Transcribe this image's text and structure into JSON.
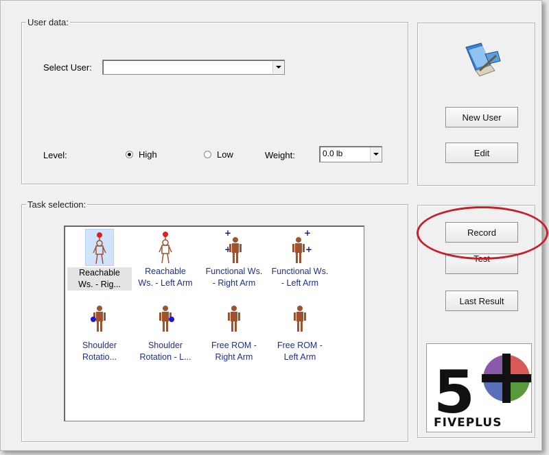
{
  "user_data": {
    "legend": "User data:",
    "select_user_label": "Select User:",
    "select_user_value": "",
    "level_label": "Level:",
    "level_high": "High",
    "level_low": "Low",
    "level_selected": "High",
    "weight_label": "Weight:",
    "weight_value": "0.0 lb"
  },
  "user_actions": {
    "new_user": "New User",
    "edit": "Edit"
  },
  "task_selection": {
    "legend": "Task selection:",
    "tasks": [
      {
        "label": "Reachable\nWs. - Rig...",
        "icon": "reach-right-figure-icon",
        "selected": true
      },
      {
        "label": "Reachable\nWs. - Left Arm",
        "icon": "reach-left-figure-icon",
        "selected": false
      },
      {
        "label": "Functional Ws.\n- Right Arm",
        "icon": "functional-right-figure-icon",
        "selected": false
      },
      {
        "label": "Functional Ws.\n- Left Arm",
        "icon": "functional-left-figure-icon",
        "selected": false
      },
      {
        "label": "Shoulder\nRotatio...",
        "icon": "shoulder-right-figure-icon",
        "selected": false
      },
      {
        "label": "Shoulder\nRotation - L...",
        "icon": "shoulder-left-figure-icon",
        "selected": false
      },
      {
        "label": "Free ROM -\nRight Arm",
        "icon": "free-rom-right-figure-icon",
        "selected": false
      },
      {
        "label": "Free ROM -\nLeft Arm",
        "icon": "free-rom-left-figure-icon",
        "selected": false
      }
    ]
  },
  "task_actions": {
    "record": "Record",
    "test": "Test",
    "last_result": "Last Result"
  },
  "logo": {
    "number": "5",
    "text": "FIVEPLUS"
  },
  "colors": {
    "annotation_circle": "#c8202a",
    "task_label": "#1f2f8f",
    "logo_red": "#d85a55",
    "logo_green": "#5a9a3a",
    "logo_blue": "#5a6fb8",
    "logo_purple": "#8a5aa8"
  }
}
